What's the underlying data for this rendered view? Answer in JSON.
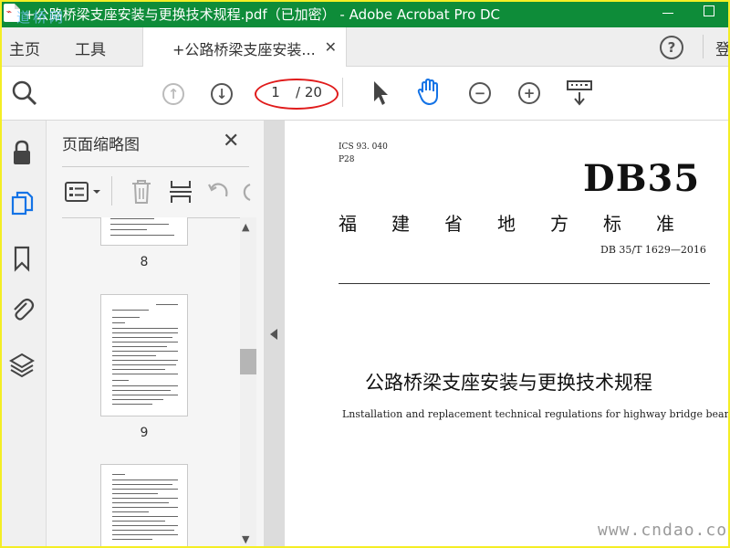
{
  "window": {
    "title": "+公路桥梁支座安装与更换技术规程.pdf（已加密） - Adobe Acrobat Pro DC",
    "watermark": "道桥网",
    "title_bar_color": "#0e8c39"
  },
  "tabs": {
    "home": "主页",
    "tools": "工具",
    "document": "+公路桥梁支座安装...",
    "login": "登"
  },
  "toolbar": {
    "current_page": "1",
    "total_pages": "/ 20",
    "highlight_color": "#e01b1b",
    "icons": [
      "magnifier-icon",
      "page-up-icon",
      "page-down-icon",
      "select-cursor-icon",
      "hand-icon",
      "zoom-out-icon",
      "zoom-in-icon",
      "keyboard-icon"
    ]
  },
  "left_rail": {
    "icons": [
      "lock-icon",
      "pages-icon",
      "bookmark-icon",
      "attachment-icon",
      "layers-icon"
    ],
    "active_color": "#1473e6"
  },
  "thumbnails": {
    "title": "页面缩略图",
    "pages": [
      "8",
      "9"
    ]
  },
  "document": {
    "ics": "ICS 93. 040",
    "code": "P28",
    "standard": "DB35",
    "province_line": "福建省地方标准",
    "number": "DB 35/T  1629—2016",
    "title_cn": "公路桥梁支座安装与更换技术规程",
    "title_en": "Lnstallation and replacement technical regulations for highway bridge bearings"
  },
  "site_watermark": "www.cndao.com"
}
